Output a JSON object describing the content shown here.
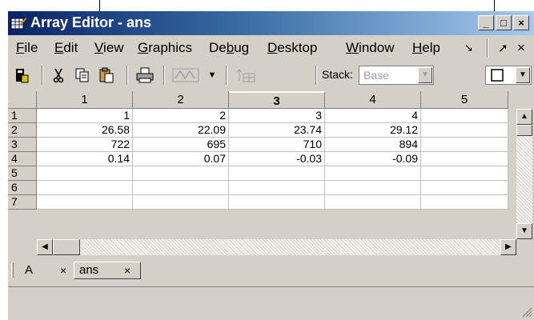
{
  "window": {
    "title": "Array Editor - ans",
    "controls": {
      "minimize": "_",
      "maximize": "□",
      "close": "×"
    }
  },
  "menu": {
    "items": [
      {
        "name": "File",
        "key": "F",
        "rest": "ile"
      },
      {
        "name": "Edit",
        "key": "E",
        "rest": "dit"
      },
      {
        "name": "View",
        "key": "V",
        "rest": "iew"
      },
      {
        "name": "Graphics",
        "key": "G",
        "rest": "raphics"
      },
      {
        "name": "Debug",
        "key": "b",
        "pre": "De",
        "rest": "ug"
      },
      {
        "name": "Desktop",
        "key": "D",
        "rest": "esktop"
      },
      {
        "name": "Window",
        "key": "W",
        "rest": "indow"
      },
      {
        "name": "Help",
        "key": "H",
        "rest": "elp"
      }
    ],
    "undock_icon": "↘",
    "close_icon": "×"
  },
  "toolbar": {
    "stack_label": "Stack:",
    "stack_value": "Base",
    "icons": [
      "import-data-icon",
      "cut-icon",
      "copy-icon",
      "paste-icon",
      "print-icon",
      "plot-icon",
      "plot-dropdown-icon",
      "workspace-icon"
    ]
  },
  "grid": {
    "columns": [
      "1",
      "2",
      "3",
      "4",
      "5"
    ],
    "rows": [
      "1",
      "2",
      "3",
      "4",
      "5",
      "6",
      "7"
    ],
    "cells": [
      [
        "1",
        "2",
        "3",
        "4",
        ""
      ],
      [
        "26.58",
        "22.09",
        "23.74",
        "29.12",
        ""
      ],
      [
        "722",
        "695",
        "710",
        "894",
        ""
      ],
      [
        "0.14",
        "0.07",
        "-0.03",
        "-0.09",
        ""
      ],
      [
        "",
        "",
        "",
        "",
        ""
      ],
      [
        "",
        "",
        "",
        "",
        ""
      ],
      [
        "",
        "",
        "",
        "",
        ""
      ]
    ],
    "selected_column": "3"
  },
  "tabs": [
    {
      "label": "A",
      "close": "×"
    },
    {
      "label": "ans",
      "close": "×"
    }
  ],
  "colors": {
    "title_gradient_start": "#0a246a",
    "title_gradient_end": "#a6caf0",
    "chrome": "#d4d0c8"
  }
}
